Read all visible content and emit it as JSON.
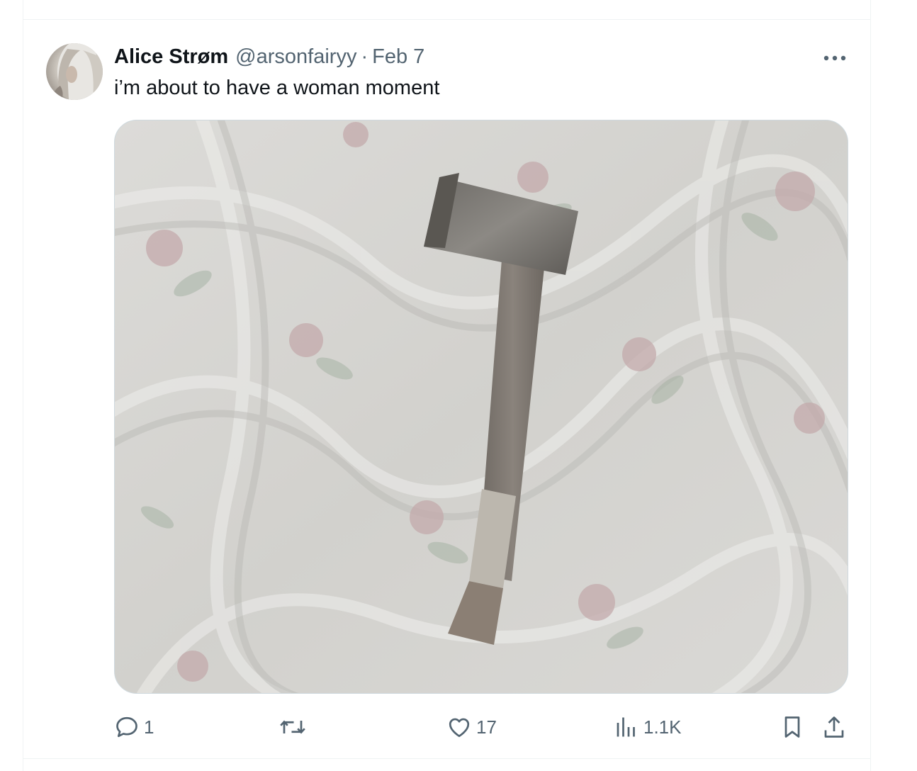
{
  "tweet": {
    "author_name": "Alice Strøm",
    "handle": "@arsonfairyy",
    "separator": "·",
    "date": "Feb 7",
    "text": "i’m about to have a woman moment"
  },
  "actions": {
    "reply_count": "1",
    "like_count": "17",
    "views_count": "1.1K"
  },
  "icons": {
    "more": "more-horizontal-icon",
    "reply": "reply-icon",
    "retweet": "retweet-icon",
    "like": "heart-icon",
    "views": "views-icon",
    "bookmark": "bookmark-icon",
    "share": "share-icon"
  },
  "colors": {
    "text_primary": "#0f1419",
    "text_secondary": "#536471",
    "border": "#eff3f4"
  }
}
